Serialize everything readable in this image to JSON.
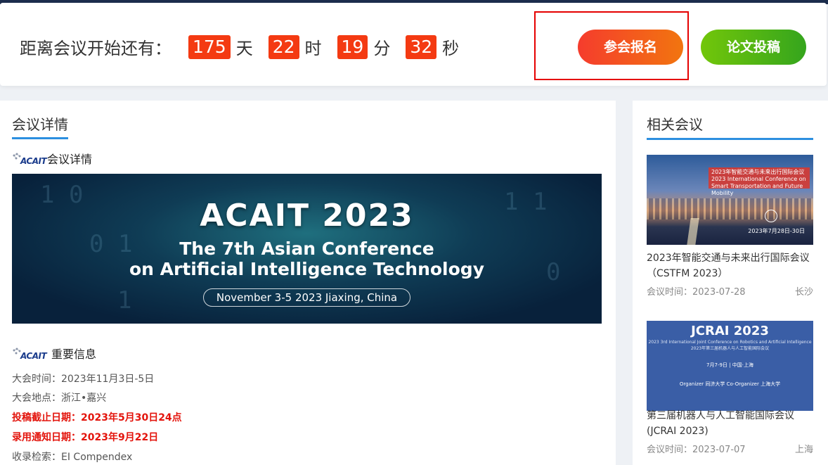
{
  "countdown": {
    "prefix": "距离会议开始还有：",
    "days": "175",
    "days_unit": "天",
    "hours": "22",
    "hours_unit": "时",
    "minutes": "19",
    "minutes_unit": "分",
    "seconds": "32",
    "seconds_unit": "秒"
  },
  "actions": {
    "register_label": "参会报名",
    "submit_label": "论文投稿"
  },
  "main": {
    "section_title": "会议详情",
    "logo_text": "ACAIT",
    "details_heading": "会议详情",
    "banner": {
      "title": "ACAIT 2023",
      "subtitle_line1": "The 7th Asian Conference",
      "subtitle_line2": "on Artificial Intelligence Technology",
      "date": "November 3-5 2023 Jiaxing, China"
    },
    "important_heading": "重要信息",
    "info": [
      {
        "text": "大会时间：2023年11月3日-5日",
        "highlight": false
      },
      {
        "text": "大会地点：浙江•嘉兴",
        "highlight": false
      },
      {
        "text": "投稿截止日期：2023年5月30日24点",
        "highlight": true
      },
      {
        "text": "录用通知日期：2023年9月22日",
        "highlight": true
      },
      {
        "text": "收录检索：EI Compendex",
        "highlight": false
      }
    ]
  },
  "sidebar": {
    "section_title": "相关会议",
    "cards": [
      {
        "image_banner": "2023年智能交通与未来出行国际会议 2023 International Conference on Smart Transportation and Future Mobility",
        "image_date": "2023年7月28日-30日",
        "title": "2023年智能交通与未来出行国际会议（CSTFM 2023）",
        "time_label": "会议时间：2023-07-28",
        "city": "长沙"
      },
      {
        "image_title": "JCRAI 2023",
        "image_sub": "2023 3rd International Joint Conference on Robotics and Artificial Intelligence 2023年第三届机器人与人工智能国际会议",
        "image_date": "7月7-9日 | 中国·上海",
        "image_org": "Organizer 同济大学    Co-Organizer 上海大学",
        "title": "第三届机器人与人工智能国际会议(JCRAI 2023)",
        "time_label": "会议时间：2023-07-07",
        "city": "上海"
      }
    ]
  },
  "colors": {
    "countdown_box": "#f43a12",
    "register_gradient": "#f53c2d",
    "submit_gradient": "#72c60a",
    "accent_line": "#2c8fe0",
    "highlight_text": "#e3140c"
  }
}
